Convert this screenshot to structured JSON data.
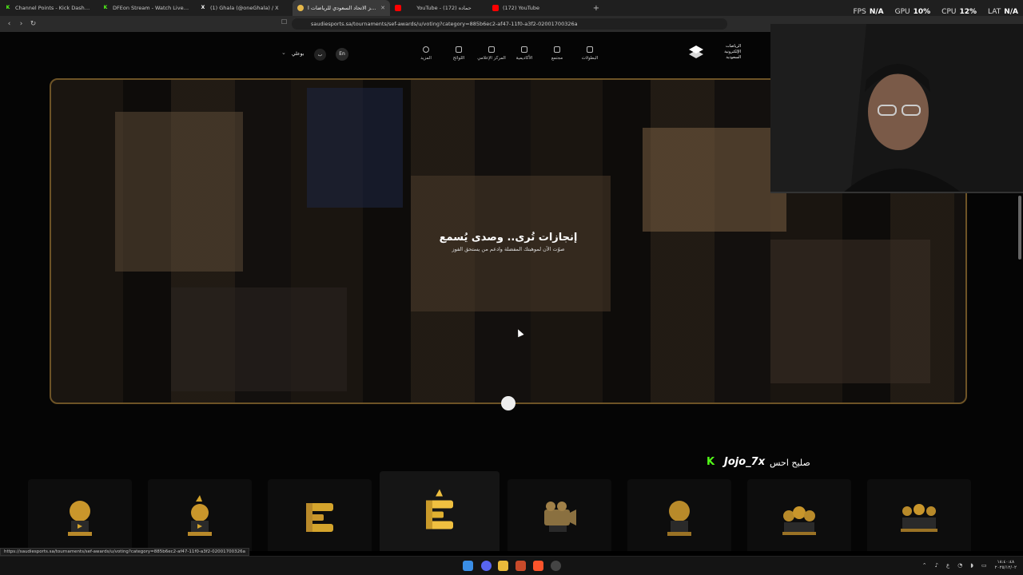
{
  "tabs": [
    {
      "title": "Channel Points - Kick Dashboard",
      "fav": "K",
      "color": "#53fc18"
    },
    {
      "title": "DFEon Stream - Watch Live on Kick",
      "fav": "K",
      "color": "#53fc18"
    },
    {
      "title": "(1) Ghala (@oneGhala) / X",
      "fav": "X",
      "color": "#ffffff"
    },
    {
      "title": "جوائز الاتحاد السعودي للرياضات ا",
      "fav": "",
      "color": "#e6b84a"
    },
    {
      "title": "YouTube - حماده (172)",
      "fav": "",
      "color": "#ff0000"
    },
    {
      "title": "(172) YouTube",
      "fav": "",
      "color": "#ff0000"
    }
  ],
  "perf": [
    {
      "label": "FPS",
      "value": "N/A"
    },
    {
      "label": "GPU",
      "value": "10%"
    },
    {
      "label": "CPU",
      "value": "12%"
    },
    {
      "label": "LAT",
      "value": "N/A"
    }
  ],
  "url": "saudiesports.sa/tournaments/sef-awards/u/voting?category=885b6ec2-af47-11f0-a3f2-02001700326a",
  "nav": [
    {
      "label": "البطولات"
    },
    {
      "label": "مجتمع"
    },
    {
      "label": "الأكاديمية"
    },
    {
      "label": "المركز الإعلامي"
    },
    {
      "label": "اللوائح"
    },
    {
      "label": "المزيد"
    }
  ],
  "logo_text": "الرياضات الإلكترونية السعودية",
  "lang": "En",
  "user_initial": "ب",
  "username": "بوعلي",
  "hero": {
    "title": "إنجازات تُرى.. وصدى يُسمع",
    "subtitle": "صوّت الآن لموهبتك المفضلة وادعم من يستحق الفوز"
  },
  "overlay": {
    "platform_icon": "K",
    "name": "Jojo_7x",
    "message": "صليح احس"
  },
  "status_link": "https://saudiesports.sa/tournaments/sef-awards/u/voting?category=885b6ec2-af47-11f0-a3f2-02001700326a",
  "clock": {
    "time": "١٨:٤٠:٤٨",
    "date": "٢٠٢٥/١٢/٠٢"
  },
  "colors": {
    "gold": "#d4a42c",
    "kick_green": "#53fc18",
    "hero_border": "#6d5326"
  }
}
